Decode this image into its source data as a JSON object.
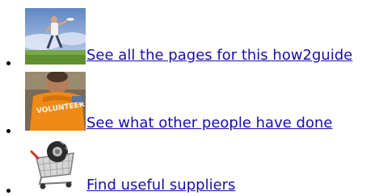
{
  "list": {
    "items": [
      {
        "label": "See all the pages for this how2guide",
        "image_icon": "person-throwing-frisbee-photo"
      },
      {
        "label": "See what other people have done",
        "image_icon": "volunteer-shirt-photo"
      },
      {
        "label": "Find useful suppliers",
        "image_icon": "shopping-trolley-icon"
      }
    ]
  },
  "colors": {
    "link": "#1a0dab",
    "bullet": "#000000",
    "background": "#ffffff"
  }
}
